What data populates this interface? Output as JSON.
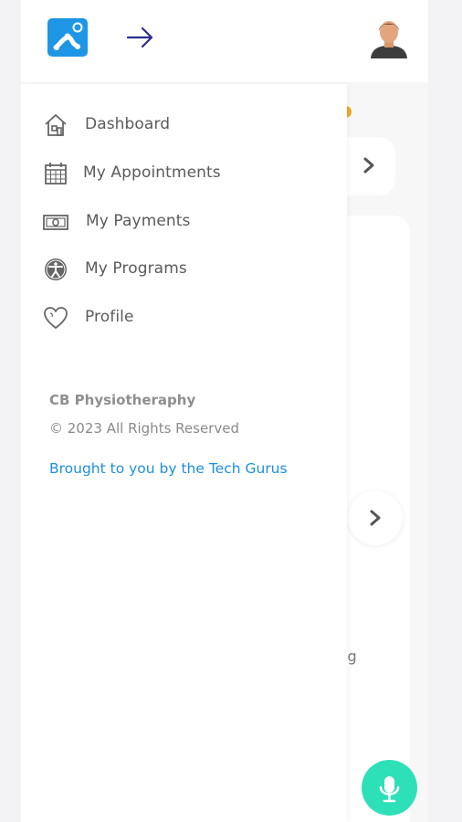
{
  "header": {
    "logo_icon": "app-logo-icon",
    "back_icon": "arrow-right-icon",
    "avatar_icon": "user-avatar-icon"
  },
  "drawer": {
    "items": [
      {
        "label": "Dashboard",
        "icon": "home-icon"
      },
      {
        "label": "My Appointments",
        "icon": "calendar-icon"
      },
      {
        "label": "My Payments",
        "icon": "payments-icon"
      },
      {
        "label": "My Programs",
        "icon": "programs-icon"
      },
      {
        "label": "Profile",
        "icon": "heart-icon"
      }
    ],
    "footer": {
      "company": "CB Physiotheraphy",
      "copyright": "© 2023 All Rights Reserved",
      "credit": "Brought to you by the Tech Gurus"
    }
  },
  "background": {
    "partial_text": "ıg"
  },
  "colors": {
    "logo": "#1e96e6",
    "arrow": "#2b2d8e",
    "credit": "#1d8fe0",
    "fab": "#2ee0b8",
    "badge": "#f5a623"
  }
}
